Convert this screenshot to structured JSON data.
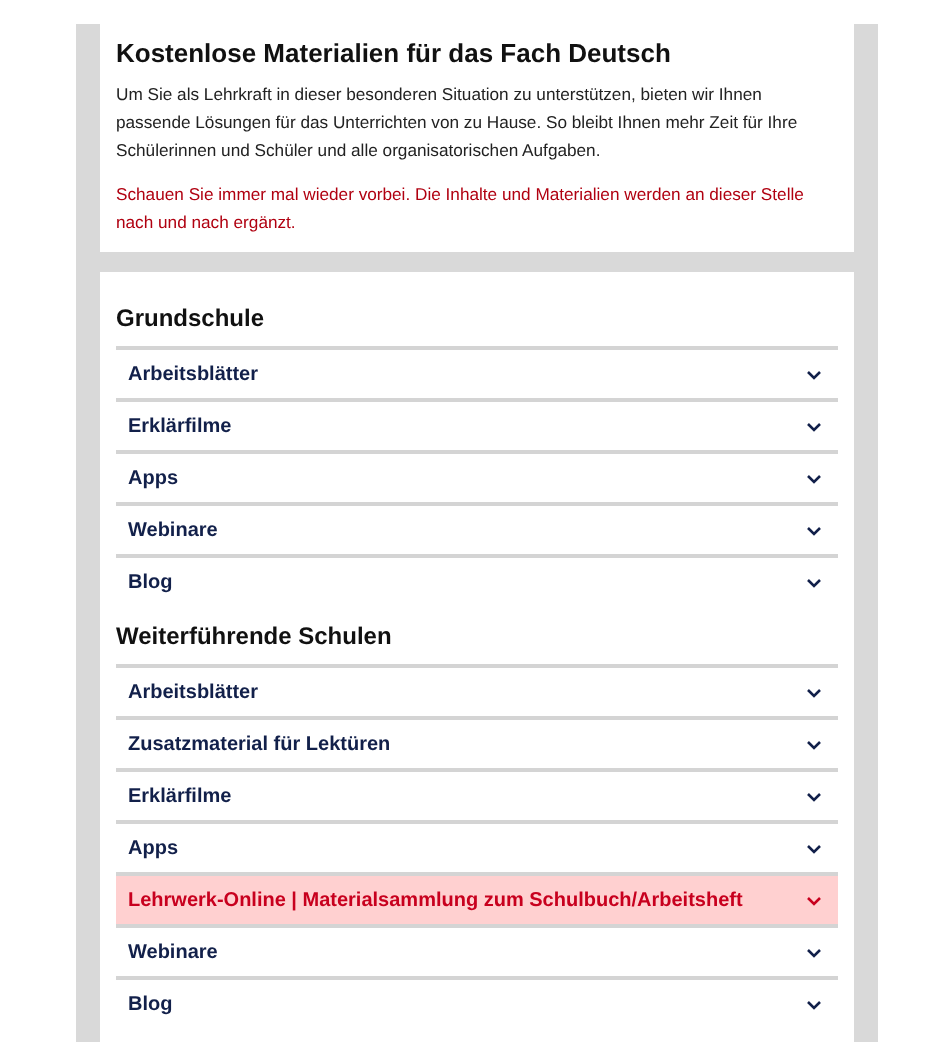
{
  "intro": {
    "title": "Kostenlose Materialien für das Fach Deutsch",
    "text": "Um Sie als Lehrkraft in dieser besonderen Situation zu unterstützen, bieten wir Ihnen passende Lösungen für das Unterrichten von zu Hause. So bleibt Ihnen mehr Zeit für Ihre Schülerinnen und Schüler und alle organisatorischen Aufgaben.",
    "notice": "Schauen Sie immer mal wieder vorbei. Die Inhalte und Materialien werden an dieser Stelle nach und nach ergänzt."
  },
  "sections": [
    {
      "heading": "Grundschule",
      "items": [
        {
          "label": "Arbeitsblätter",
          "highlighted": false
        },
        {
          "label": "Erklärfilme",
          "highlighted": false
        },
        {
          "label": "Apps",
          "highlighted": false
        },
        {
          "label": "Webinare",
          "highlighted": false
        },
        {
          "label": "Blog",
          "highlighted": false
        }
      ]
    },
    {
      "heading": "Weiterführende Schulen",
      "items": [
        {
          "label": "Arbeitsblätter",
          "highlighted": false
        },
        {
          "label": "Zusatzmaterial für Lektüren",
          "highlighted": false
        },
        {
          "label": "Erklärfilme",
          "highlighted": false
        },
        {
          "label": "Apps",
          "highlighted": false
        },
        {
          "label": "Lehrwerk-Online | Materialsammlung zum Schulbuch/Arbeitsheft",
          "highlighted": true
        },
        {
          "label": "Webinare",
          "highlighted": false
        },
        {
          "label": "Blog",
          "highlighted": false
        }
      ]
    }
  ]
}
